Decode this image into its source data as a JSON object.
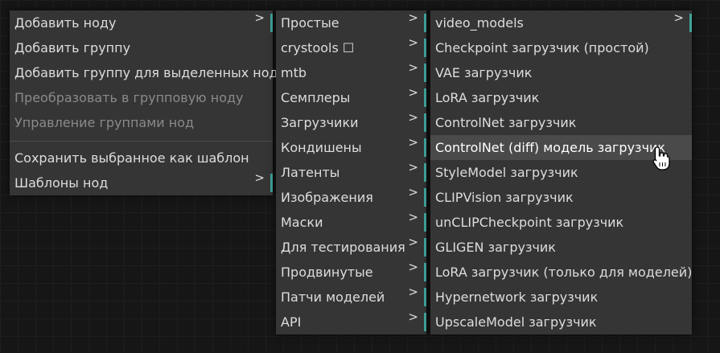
{
  "menu1": {
    "items": [
      {
        "label": "Добавить ноду",
        "arrow": ">"
      },
      {
        "label": "Добавить группу"
      },
      {
        "label": "Добавить группу для выделенных нод"
      },
      {
        "label": "Преобразовать в групповую ноду"
      },
      {
        "label": "Управление группами нод"
      },
      {
        "label": "Сохранить выбранное как шаблон"
      },
      {
        "label": "Шаблоны нод",
        "arrow": ">"
      }
    ]
  },
  "menu2": {
    "items": [
      {
        "label": "Простые",
        "arrow": ">"
      },
      {
        "label": "crystools ☐",
        "arrow": ">"
      },
      {
        "label": "mtb",
        "arrow": ">"
      },
      {
        "label": "Семплеры",
        "arrow": ">"
      },
      {
        "label": "Загрузчики",
        "arrow": ">"
      },
      {
        "label": "Кондишены",
        "arrow": ">"
      },
      {
        "label": "Латенты",
        "arrow": ">"
      },
      {
        "label": "Изображения",
        "arrow": ">"
      },
      {
        "label": "Маски",
        "arrow": ">"
      },
      {
        "label": "Для тестирования",
        "arrow": ">"
      },
      {
        "label": "Продвинутые",
        "arrow": ">"
      },
      {
        "label": "Патчи моделей",
        "arrow": ">"
      },
      {
        "label": "API",
        "arrow": ">"
      }
    ]
  },
  "menu3": {
    "items": [
      {
        "label": "video_models",
        "arrow": ">"
      },
      {
        "label": "Checkpoint загрузчик (простой)"
      },
      {
        "label": "VAE загрузчик"
      },
      {
        "label": "LoRA загрузчик"
      },
      {
        "label": "ControlNet загрузчик"
      },
      {
        "label": "ControlNet (diff) модель загрузчик"
      },
      {
        "label": "StyleModel загрузчик"
      },
      {
        "label": "CLIPVision загрузчик"
      },
      {
        "label": "unCLIPCheckpoint загрузчик"
      },
      {
        "label": "GLIGEN загрузчик"
      },
      {
        "label": "LoRA загрузчик (только для моделей)"
      },
      {
        "label": "Hypernetwork загрузчик"
      },
      {
        "label": "UpscaleModel загрузчик"
      }
    ]
  },
  "colors": {
    "accent": "#3fa39a",
    "menu_bg": "#353535",
    "highlight_bg": "#4a4a4a"
  }
}
